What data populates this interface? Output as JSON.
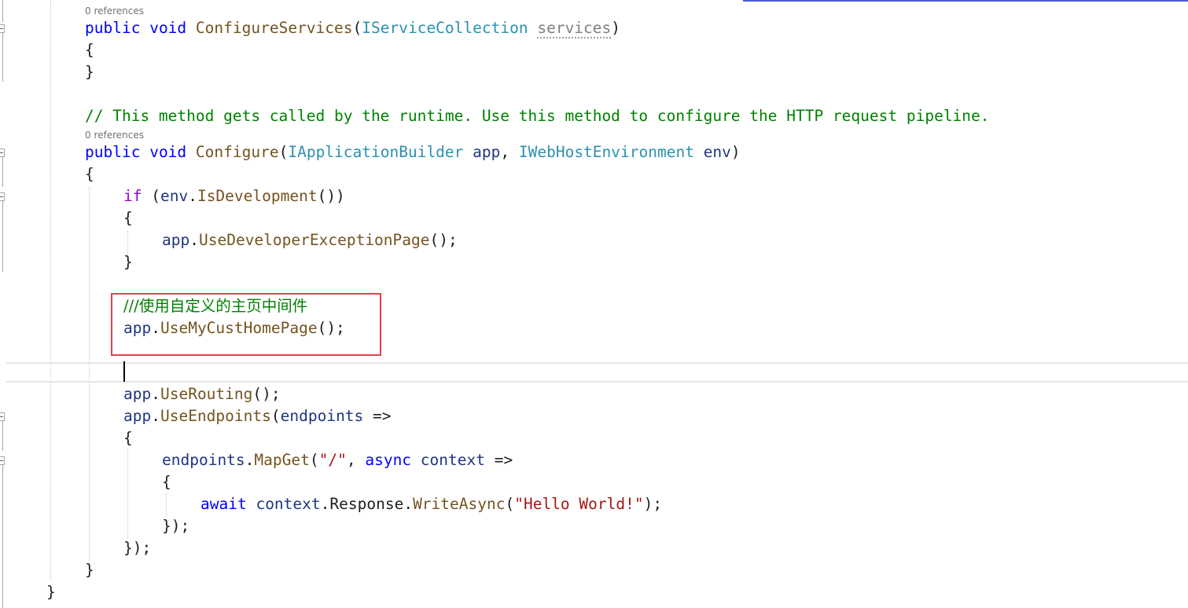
{
  "editor": {
    "codelens_1": "0 references",
    "codelens_2": "0 references",
    "configure_services": {
      "public": "public",
      "void": "void",
      "name": "ConfigureServices",
      "param_type": "IServiceCollection",
      "param_name": "services"
    },
    "comment_pipeline": "// This method gets called by the runtime. Use this method to configure the HTTP request pipeline.",
    "configure": {
      "public": "public",
      "void": "void",
      "name": "Configure",
      "type1": "IApplicationBuilder",
      "param1": "app",
      "type2": "IWebHostEnvironment",
      "param2": "env"
    },
    "if_block": {
      "kw": "if",
      "env": "env",
      "method": "IsDevelopment"
    },
    "dev_page": {
      "obj": "app",
      "method": "UseDeveloperExceptionPage"
    },
    "custom_comment": "///使用自定义的主页中间件",
    "custom_call": {
      "obj": "app",
      "method": "UseMyCustHomePage"
    },
    "routing": {
      "obj": "app",
      "method": "UseRouting"
    },
    "endpoints_call": {
      "obj": "app",
      "method": "UseEndpoints",
      "param": "endpoints"
    },
    "mapget": {
      "obj": "endpoints",
      "method": "MapGet",
      "route": "\"/\"",
      "async": "async",
      "ctx": "context"
    },
    "await_line": {
      "await": "await",
      "ctx": "context",
      "resp": "Response",
      "method": "WriteAsync",
      "str": "\"Hello World!\""
    }
  },
  "colors": {
    "keyword": "#0000ff",
    "control_keyword": "#8f08c4",
    "type": "#2b91af",
    "method": "#74531f",
    "variable": "#1f377f",
    "string": "#a31515",
    "comment": "#008000",
    "highlight_box": "#e0434a"
  }
}
